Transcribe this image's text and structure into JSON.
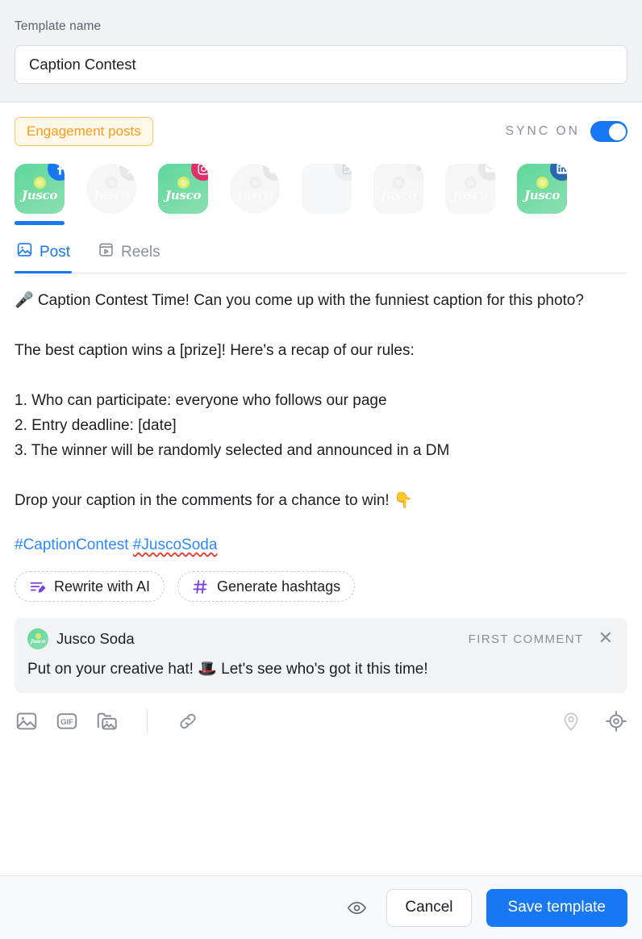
{
  "header": {
    "label": "Template name",
    "template_name_value": "Caption Contest",
    "template_name_placeholder": "Template name"
  },
  "toolbar_top": {
    "tag_label": "Engagement posts",
    "sync_label": "SYNC ON",
    "sync_state": "on",
    "accent_blue": "#1877f2",
    "tag_color": "#f79a1e"
  },
  "accounts": [
    {
      "name": "Jusco",
      "network": "facebook",
      "badge_icon": "facebook-icon",
      "selected": true,
      "enabled": true,
      "shape": "square"
    },
    {
      "name": "Jusco",
      "network": "x",
      "badge_icon": "x-icon",
      "selected": false,
      "enabled": false,
      "shape": "round"
    },
    {
      "name": "Jusco",
      "network": "instagram",
      "badge_icon": "instagram-icon",
      "selected": false,
      "enabled": true,
      "shape": "square"
    },
    {
      "name": "Jusco",
      "network": "youtube",
      "badge_icon": "youtube-icon",
      "selected": false,
      "enabled": false,
      "shape": "round"
    },
    {
      "name": "",
      "network": "gmb",
      "badge_icon": "clipboard-icon",
      "selected": false,
      "enabled": false,
      "shape": "square"
    },
    {
      "name": "Jusco",
      "network": "threads",
      "badge_icon": "feather-icon",
      "selected": false,
      "enabled": false,
      "shape": "square"
    },
    {
      "name": "Jusco",
      "network": "email",
      "badge_icon": "envelope-icon",
      "selected": false,
      "enabled": false,
      "shape": "square"
    },
    {
      "name": "Jusco",
      "network": "linkedin",
      "badge_icon": "linkedin-icon",
      "selected": false,
      "enabled": true,
      "shape": "square"
    }
  ],
  "tabs": [
    {
      "label": "Post",
      "icon": "image-icon",
      "active": true
    },
    {
      "label": "Reels",
      "icon": "reels-icon",
      "active": false
    }
  ],
  "post": {
    "body": "🎤 Caption Contest Time! Can you come up with the funniest caption for this photo?\n\nThe best caption wins a [prize]! Here's a recap of our rules:\n\n1. Who can participate: everyone who follows our page\n2. Entry deadline: [date]\n3. The winner will be randomly selected and announced in a DM\n\nDrop your caption in the comments for a chance to win! 👇",
    "hashtag_1": "#CaptionContest ",
    "hashtag_2": "#JuscoSoda"
  },
  "ai_actions": [
    {
      "label": "Rewrite with AI",
      "icon": "rewrite-ai-icon"
    },
    {
      "label": "Generate hashtags",
      "icon": "hashtag-icon"
    }
  ],
  "first_comment": {
    "author": "Jusco Soda",
    "tag": "FIRST COMMENT",
    "close_icon": "close-icon",
    "text": "Put on your creative hat! 🎩 Let's see who's got it this time!"
  },
  "attachments": [
    {
      "name": "add-image-button",
      "icon": "image-icon"
    },
    {
      "name": "add-gif-button",
      "icon": "gif-icon",
      "label": "GIF"
    },
    {
      "name": "media-library-button",
      "icon": "media-folder-icon"
    },
    {
      "name": "add-link-button",
      "icon": "link-icon"
    }
  ],
  "attachments_right": [
    {
      "name": "location-button",
      "icon": "location-pin-icon",
      "disabled": true
    },
    {
      "name": "targeting-button",
      "icon": "target-icon",
      "disabled": false
    }
  ],
  "footer": {
    "preview_icon": "eye-icon",
    "cancel_label": "Cancel",
    "save_label": "Save template"
  }
}
